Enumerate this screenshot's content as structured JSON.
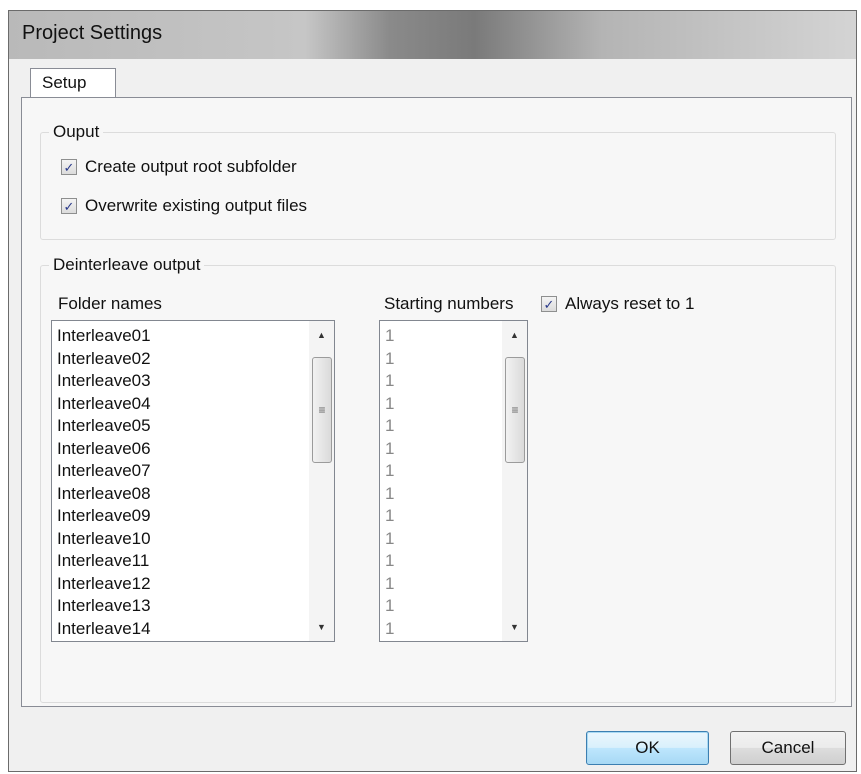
{
  "window": {
    "title": "Project Settings"
  },
  "tabs": [
    {
      "label": "Setup"
    }
  ],
  "output_group": {
    "label": "Ouput",
    "create_subfolder": {
      "label": "Create output root subfolder",
      "checked": true
    },
    "overwrite_files": {
      "label": "Overwrite existing output files",
      "checked": true
    }
  },
  "deinterleave_group": {
    "label": "Deinterleave output",
    "folder_names_label": "Folder names",
    "starting_numbers_label": "Starting numbers",
    "always_reset": {
      "label": "Always reset to 1",
      "checked": true
    },
    "folder_names": [
      "Interleave01",
      "Interleave02",
      "Interleave03",
      "Interleave04",
      "Interleave05",
      "Interleave06",
      "Interleave07",
      "Interleave08",
      "Interleave09",
      "Interleave10",
      "Interleave11",
      "Interleave12",
      "Interleave13",
      "Interleave14"
    ],
    "starting_numbers": [
      "1",
      "1",
      "1",
      "1",
      "1",
      "1",
      "1",
      "1",
      "1",
      "1",
      "1",
      "1",
      "1",
      "1"
    ]
  },
  "buttons": {
    "ok": "OK",
    "cancel": "Cancel"
  },
  "icons": {
    "check": "checkmark-icon",
    "scroll_up": "scroll-up-arrow-icon",
    "scroll_down": "scroll-down-arrow-icon",
    "grip": "scroll-thumb-grip-icon"
  }
}
